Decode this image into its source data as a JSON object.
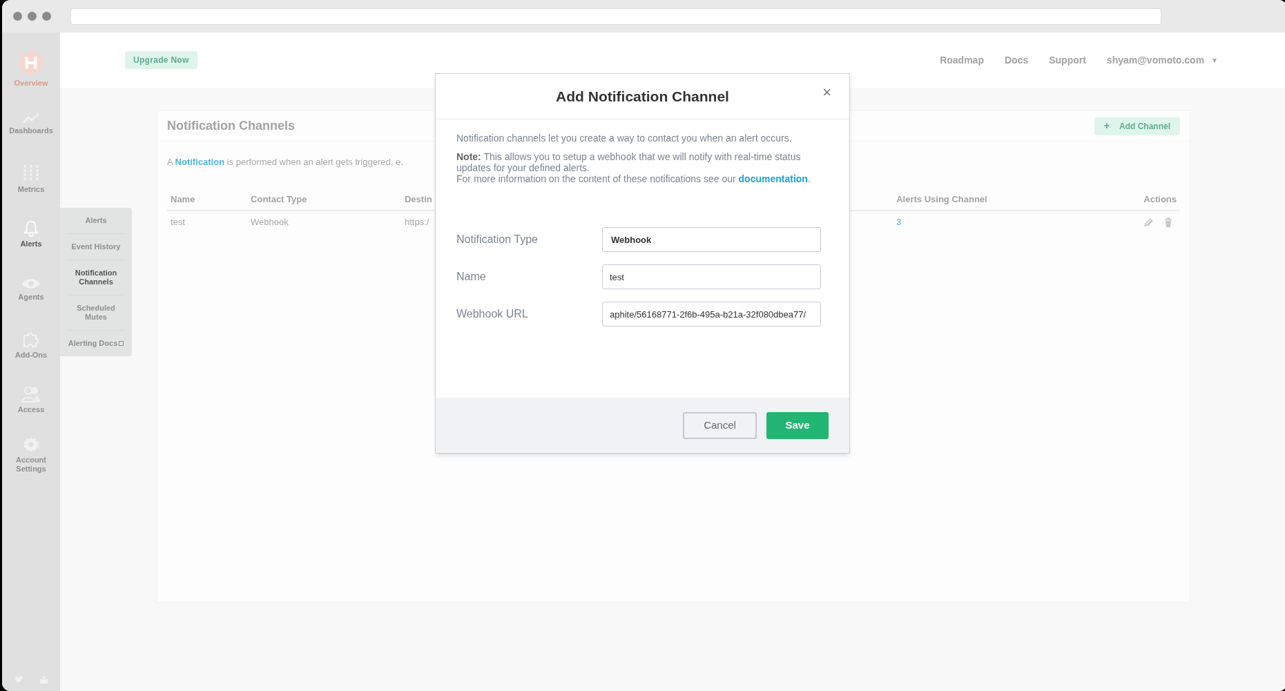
{
  "sidebar": {
    "items": [
      {
        "kind": "logo",
        "label": "Overview",
        "selected": false
      },
      {
        "kind": "chart",
        "label": "Dashboards",
        "selected": false
      },
      {
        "kind": "bars",
        "label": "Metrics",
        "selected": false
      },
      {
        "kind": "bell",
        "label": "Alerts",
        "selected": true
      },
      {
        "kind": "eye",
        "label": "Agents",
        "selected": false
      },
      {
        "kind": "puzzle",
        "label": "Add-Ons",
        "selected": false
      },
      {
        "kind": "users",
        "label": "Access",
        "selected": false
      },
      {
        "kind": "gear",
        "label": "Account Settings",
        "selected": false
      }
    ]
  },
  "submenu": {
    "items": [
      {
        "label": "Alerts",
        "selected": false
      },
      {
        "label": "Event History",
        "selected": false
      },
      {
        "label": "Notification Channels",
        "selected": true
      },
      {
        "label": "Scheduled Mutes",
        "selected": false
      },
      {
        "label": "Alerting Docs",
        "selected": false,
        "external": true
      }
    ]
  },
  "header": {
    "upgrade_button": "Upgrade Now",
    "links": [
      "Roadmap",
      "Docs",
      "Support"
    ],
    "user": "shyam@vomoto.com",
    "user_caret": "▼"
  },
  "page": {
    "title": "Notification Channels",
    "add_button": "Add Channel",
    "add_icon": "+",
    "description": "A **Notification** is performed when an alert gets triggered, e.",
    "table": {
      "columns": [
        "Name",
        "Contact Type",
        "Destin",
        "Alerts Using Channel",
        "Actions"
      ],
      "rows": [
        {
          "name": "test",
          "contact_type": "Webhook",
          "destination": "https:/",
          "alerts_using_channel": "3"
        }
      ]
    }
  },
  "modal": {
    "title": "Add Notification Channel",
    "close": "×",
    "intro": "Notification channels let you create a way to contact you when an alert occurs.",
    "note": "**Note:** This allows you to setup a webhook that we will notify with real-time status updates for your defined alerts.",
    "more": "For more information on the content of these notifications see our",
    "link": "documentation",
    "link_after": ".",
    "fields": [
      {
        "label": "Notification Type",
        "value": "Webhook",
        "kind": "select"
      },
      {
        "label": "Name",
        "value": "test",
        "kind": "text"
      },
      {
        "label": "Webhook URL",
        "value": "aphite/56168771-2f6b-495a-b21a-32f080dbea77/",
        "kind": "text"
      }
    ],
    "cancel": "Cancel",
    "save": "Save"
  }
}
